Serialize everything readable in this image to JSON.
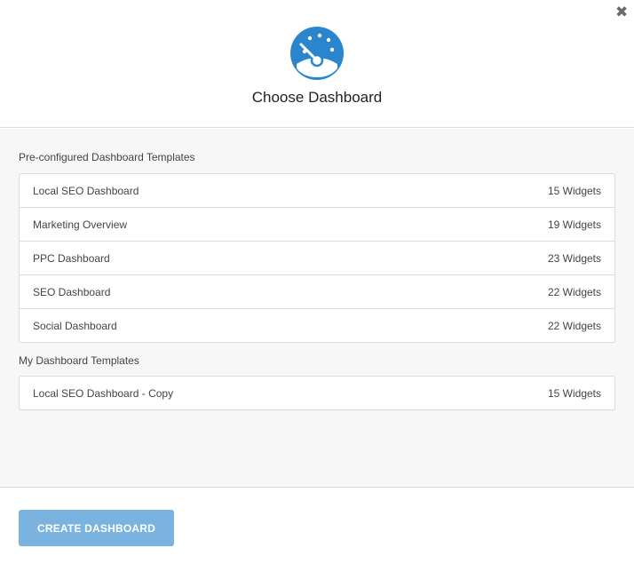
{
  "dialog": {
    "title": "Choose Dashboard",
    "close_icon": "close-icon",
    "logo_icon": "speedometer-icon"
  },
  "preconfigured": {
    "label": "Pre-configured Dashboard Templates",
    "items": [
      {
        "name": "Local SEO Dashboard",
        "widgets": "15 Widgets"
      },
      {
        "name": "Marketing Overview",
        "widgets": "19 Widgets"
      },
      {
        "name": "PPC Dashboard",
        "widgets": "23 Widgets"
      },
      {
        "name": "SEO Dashboard",
        "widgets": "22 Widgets"
      },
      {
        "name": "Social Dashboard",
        "widgets": "22 Widgets"
      }
    ]
  },
  "mine": {
    "label": "My Dashboard Templates",
    "items": [
      {
        "name": "Local SEO Dashboard - Copy",
        "widgets": "15 Widgets"
      }
    ]
  },
  "footer": {
    "create_label": "CREATE DASHBOARD"
  },
  "colors": {
    "accent": "#2b85cc",
    "button": "#7ab3e0"
  }
}
